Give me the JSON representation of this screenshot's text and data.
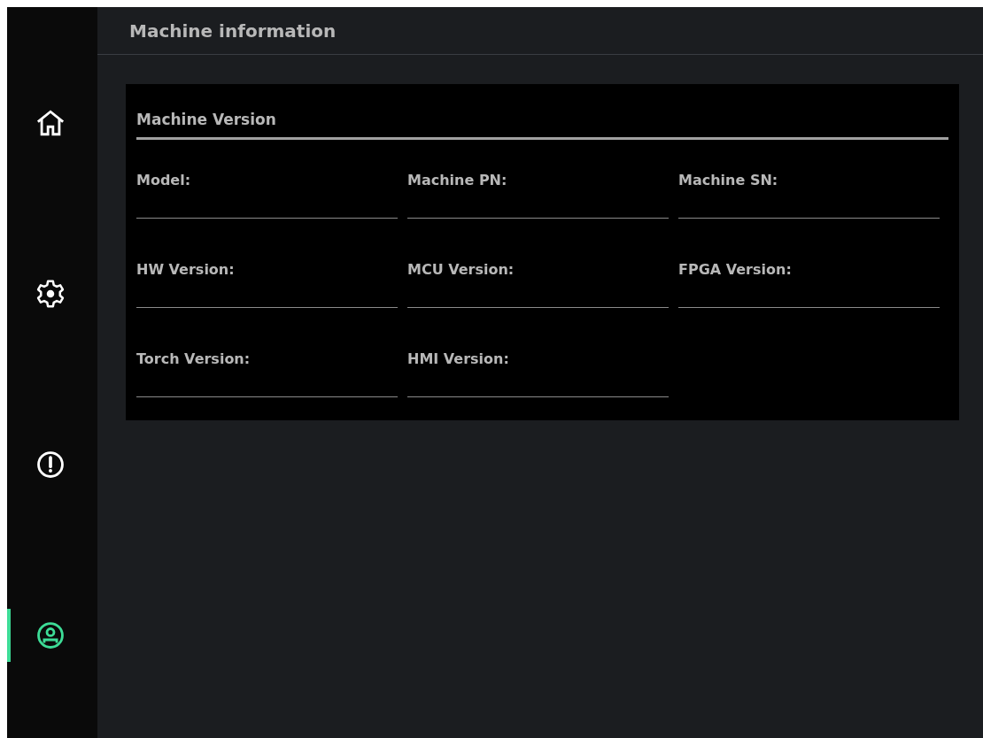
{
  "sidebar": {
    "items": [
      {
        "kind": "home",
        "selected": false
      },
      {
        "kind": "settings",
        "selected": false
      },
      {
        "kind": "alert",
        "selected": false
      },
      {
        "kind": "user",
        "selected": true
      }
    ]
  },
  "header": {
    "title": "Machine information"
  },
  "card": {
    "title": "Machine Version",
    "fields": [
      {
        "label": "Model:"
      },
      {
        "label": "Machine PN:"
      },
      {
        "label": "Machine SN:"
      },
      {
        "label": "HW Version:"
      },
      {
        "label": "MCU Version:"
      },
      {
        "label": "FPGA Version:"
      },
      {
        "label": "Torch Version:"
      },
      {
        "label": "HMI Version:"
      }
    ]
  }
}
